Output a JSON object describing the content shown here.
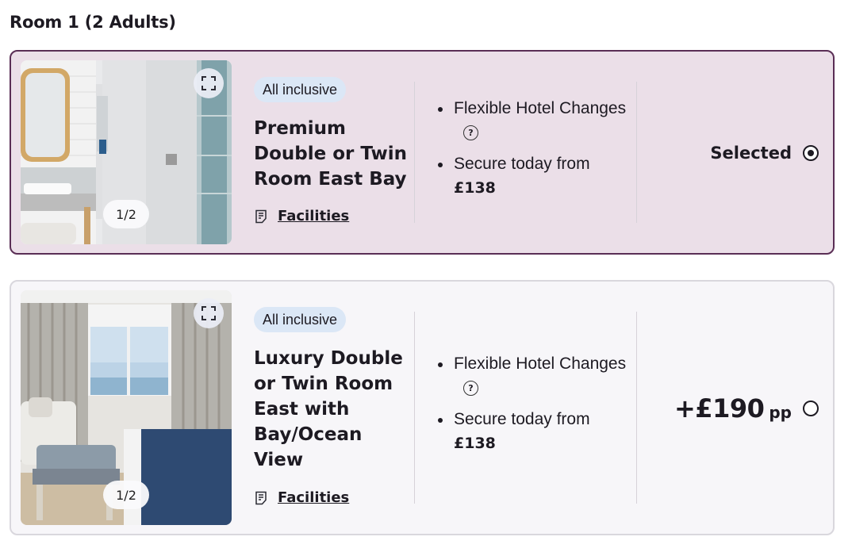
{
  "section": {
    "title": "Room 1 (2 Adults)"
  },
  "rooms": [
    {
      "board": "All inclusive",
      "name": "Premium Double or Twin Room East Bay",
      "facilities_label": "Facilities",
      "image_counter": "1/2",
      "features": {
        "flex": "Flexible Hotel Changes",
        "secure": "Secure today from",
        "secure_price": "£138"
      },
      "status_label": "Selected",
      "selected": true
    },
    {
      "board": "All inclusive",
      "name": "Luxury Double or Twin Room East with Bay/Ocean View",
      "facilities_label": "Facilities",
      "image_counter": "1/2",
      "features": {
        "flex": "Flexible Hotel Changes",
        "secure": "Secure today from",
        "secure_price": "£138"
      },
      "price_diff": "+£190",
      "price_unit": "pp",
      "selected": false
    }
  ],
  "colors": {
    "selected_bg": "#ebdfe8",
    "selected_border": "#5a2e55",
    "badge_bg": "#dbe7f6"
  }
}
